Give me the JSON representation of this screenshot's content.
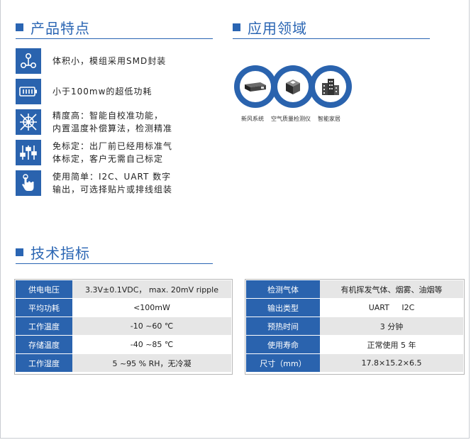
{
  "features_section": {
    "title": "产品特点"
  },
  "applications_section": {
    "title": "应用领域",
    "items": [
      {
        "label": "新风系统",
        "icon": "air-purifier-device-icon"
      },
      {
        "label": "空气质量检测仪",
        "icon": "air-quality-monitor-icon"
      },
      {
        "label": "智能家居",
        "icon": "smart-building-icon"
      }
    ]
  },
  "features": [
    {
      "icon": "connection-nodes-icon",
      "line1": "体积小，模组采用SMD封装",
      "line2": ""
    },
    {
      "icon": "battery-icon",
      "line1": "小于100mw的超低功耗",
      "line2": ""
    },
    {
      "icon": "precision-target-icon",
      "line1": "精度高：智能自校准功能，",
      "line2": "内置温度补偿算法，检测精准"
    },
    {
      "icon": "sliders-icon",
      "line1": "免标定：出厂前已经用标准气",
      "line2": "体标定，客户无需自己标定"
    },
    {
      "icon": "hand-pointer-icon",
      "line1": "使用简单：I2C、UART 数字",
      "line2": "输出，可选择贴片或排线组装"
    }
  ],
  "specs_section": {
    "title": "技术指标"
  },
  "spec_table_left": [
    {
      "key": "供电电压",
      "value": "3.3V±0.1VDC， max. 20mV ripple"
    },
    {
      "key": "平均功耗",
      "value": "<100mW"
    },
    {
      "key": "工作温度",
      "value": "-10 ~60 ℃"
    },
    {
      "key": "存储温度",
      "value": "-40 ~85 ℃"
    },
    {
      "key": "工作湿度",
      "value": "5 ~95 % RH，无冷凝"
    }
  ],
  "spec_table_right": [
    {
      "key": "检测气体",
      "value": "有机挥发气体、烟雾、油烟等"
    },
    {
      "key": "输出类型",
      "value": "UART     I2C"
    },
    {
      "key": "预热时间",
      "value": "3 分钟"
    },
    {
      "key": "使用寿命",
      "value": "正常使用 5 年"
    },
    {
      "key": "尺寸（mm）",
      "value": "17.8×15.2×6.5"
    }
  ],
  "colors": {
    "accent": "#2a65b3",
    "table_key_bg": "#2a63ae",
    "row_gray": "#e6e6e6"
  }
}
